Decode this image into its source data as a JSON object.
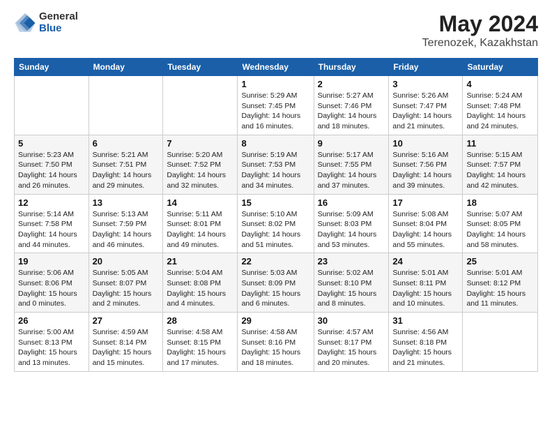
{
  "logo": {
    "general": "General",
    "blue": "Blue"
  },
  "title": "May 2024",
  "subtitle": "Terenozek, Kazakhstan",
  "days": [
    "Sunday",
    "Monday",
    "Tuesday",
    "Wednesday",
    "Thursday",
    "Friday",
    "Saturday"
  ],
  "weeks": [
    [
      {
        "date": "",
        "info": ""
      },
      {
        "date": "",
        "info": ""
      },
      {
        "date": "",
        "info": ""
      },
      {
        "date": "1",
        "info": "Sunrise: 5:29 AM\nSunset: 7:45 PM\nDaylight: 14 hours and 16 minutes."
      },
      {
        "date": "2",
        "info": "Sunrise: 5:27 AM\nSunset: 7:46 PM\nDaylight: 14 hours and 18 minutes."
      },
      {
        "date": "3",
        "info": "Sunrise: 5:26 AM\nSunset: 7:47 PM\nDaylight: 14 hours and 21 minutes."
      },
      {
        "date": "4",
        "info": "Sunrise: 5:24 AM\nSunset: 7:48 PM\nDaylight: 14 hours and 24 minutes."
      }
    ],
    [
      {
        "date": "5",
        "info": "Sunrise: 5:23 AM\nSunset: 7:50 PM\nDaylight: 14 hours and 26 minutes."
      },
      {
        "date": "6",
        "info": "Sunrise: 5:21 AM\nSunset: 7:51 PM\nDaylight: 14 hours and 29 minutes."
      },
      {
        "date": "7",
        "info": "Sunrise: 5:20 AM\nSunset: 7:52 PM\nDaylight: 14 hours and 32 minutes."
      },
      {
        "date": "8",
        "info": "Sunrise: 5:19 AM\nSunset: 7:53 PM\nDaylight: 14 hours and 34 minutes."
      },
      {
        "date": "9",
        "info": "Sunrise: 5:17 AM\nSunset: 7:55 PM\nDaylight: 14 hours and 37 minutes."
      },
      {
        "date": "10",
        "info": "Sunrise: 5:16 AM\nSunset: 7:56 PM\nDaylight: 14 hours and 39 minutes."
      },
      {
        "date": "11",
        "info": "Sunrise: 5:15 AM\nSunset: 7:57 PM\nDaylight: 14 hours and 42 minutes."
      }
    ],
    [
      {
        "date": "12",
        "info": "Sunrise: 5:14 AM\nSunset: 7:58 PM\nDaylight: 14 hours and 44 minutes."
      },
      {
        "date": "13",
        "info": "Sunrise: 5:13 AM\nSunset: 7:59 PM\nDaylight: 14 hours and 46 minutes."
      },
      {
        "date": "14",
        "info": "Sunrise: 5:11 AM\nSunset: 8:01 PM\nDaylight: 14 hours and 49 minutes."
      },
      {
        "date": "15",
        "info": "Sunrise: 5:10 AM\nSunset: 8:02 PM\nDaylight: 14 hours and 51 minutes."
      },
      {
        "date": "16",
        "info": "Sunrise: 5:09 AM\nSunset: 8:03 PM\nDaylight: 14 hours and 53 minutes."
      },
      {
        "date": "17",
        "info": "Sunrise: 5:08 AM\nSunset: 8:04 PM\nDaylight: 14 hours and 55 minutes."
      },
      {
        "date": "18",
        "info": "Sunrise: 5:07 AM\nSunset: 8:05 PM\nDaylight: 14 hours and 58 minutes."
      }
    ],
    [
      {
        "date": "19",
        "info": "Sunrise: 5:06 AM\nSunset: 8:06 PM\nDaylight: 15 hours and 0 minutes."
      },
      {
        "date": "20",
        "info": "Sunrise: 5:05 AM\nSunset: 8:07 PM\nDaylight: 15 hours and 2 minutes."
      },
      {
        "date": "21",
        "info": "Sunrise: 5:04 AM\nSunset: 8:08 PM\nDaylight: 15 hours and 4 minutes."
      },
      {
        "date": "22",
        "info": "Sunrise: 5:03 AM\nSunset: 8:09 PM\nDaylight: 15 hours and 6 minutes."
      },
      {
        "date": "23",
        "info": "Sunrise: 5:02 AM\nSunset: 8:10 PM\nDaylight: 15 hours and 8 minutes."
      },
      {
        "date": "24",
        "info": "Sunrise: 5:01 AM\nSunset: 8:11 PM\nDaylight: 15 hours and 10 minutes."
      },
      {
        "date": "25",
        "info": "Sunrise: 5:01 AM\nSunset: 8:12 PM\nDaylight: 15 hours and 11 minutes."
      }
    ],
    [
      {
        "date": "26",
        "info": "Sunrise: 5:00 AM\nSunset: 8:13 PM\nDaylight: 15 hours and 13 minutes."
      },
      {
        "date": "27",
        "info": "Sunrise: 4:59 AM\nSunset: 8:14 PM\nDaylight: 15 hours and 15 minutes."
      },
      {
        "date": "28",
        "info": "Sunrise: 4:58 AM\nSunset: 8:15 PM\nDaylight: 15 hours and 17 minutes."
      },
      {
        "date": "29",
        "info": "Sunrise: 4:58 AM\nSunset: 8:16 PM\nDaylight: 15 hours and 18 minutes."
      },
      {
        "date": "30",
        "info": "Sunrise: 4:57 AM\nSunset: 8:17 PM\nDaylight: 15 hours and 20 minutes."
      },
      {
        "date": "31",
        "info": "Sunrise: 4:56 AM\nSunset: 8:18 PM\nDaylight: 15 hours and 21 minutes."
      },
      {
        "date": "",
        "info": ""
      }
    ]
  ]
}
